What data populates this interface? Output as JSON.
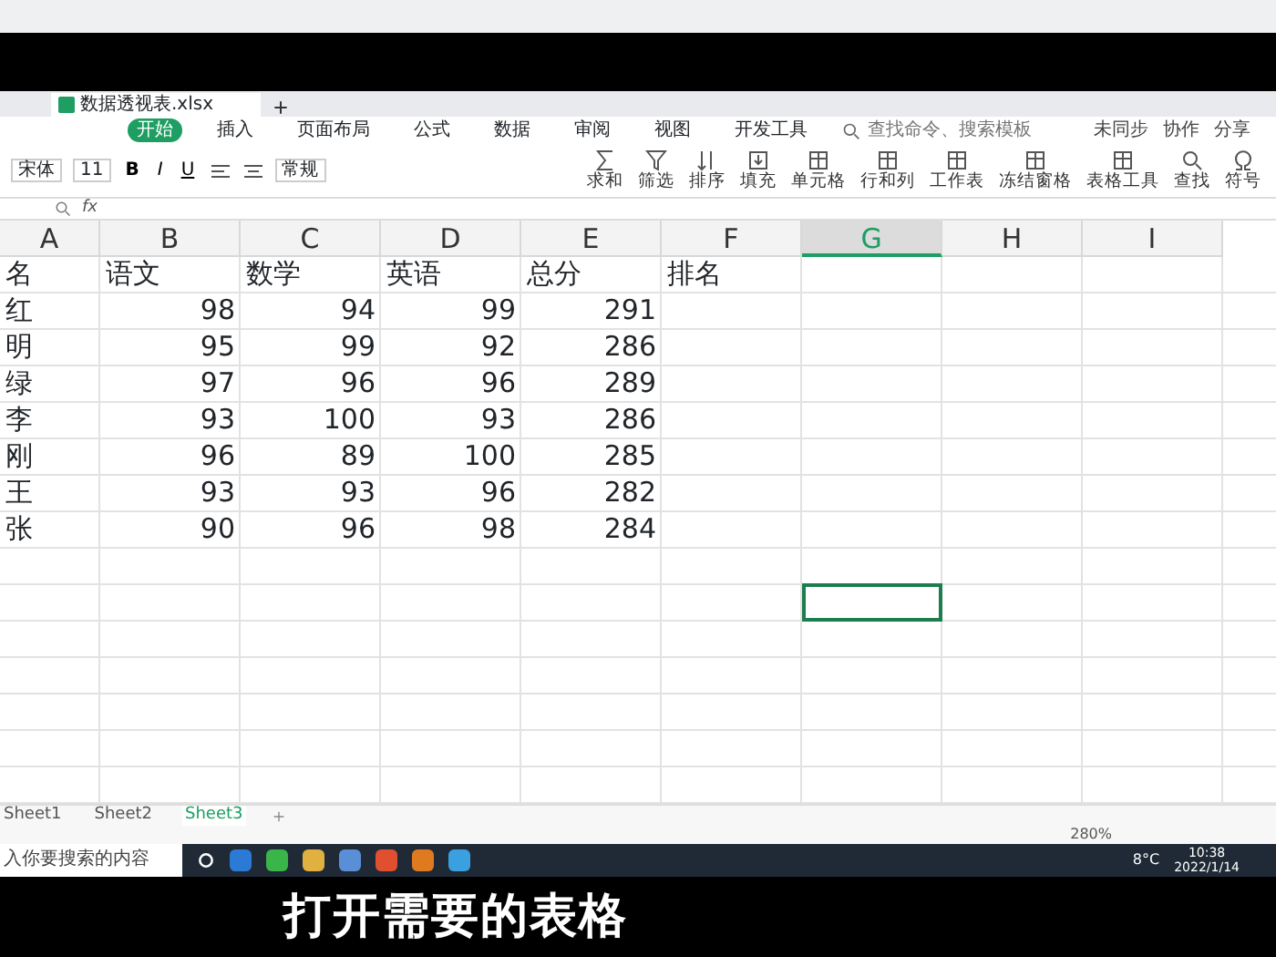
{
  "window": {
    "tab_title": "数据透视表.xlsx"
  },
  "menu_tabs": [
    {
      "label": "开始",
      "selected": true
    },
    {
      "label": "插入",
      "selected": false
    },
    {
      "label": "页面布局",
      "selected": false
    },
    {
      "label": "公式",
      "selected": false
    },
    {
      "label": "数据",
      "selected": false
    },
    {
      "label": "审阅",
      "selected": false
    },
    {
      "label": "视图",
      "selected": false
    },
    {
      "label": "开发工具",
      "selected": false
    }
  ],
  "search": {
    "placeholder": "查找命令、搜索模板"
  },
  "account": [
    "未同步",
    "协作",
    "分享"
  ],
  "ribbon": {
    "font_name": "宋体",
    "font_size": "11",
    "number_format": "常规",
    "format_buttons": [
      "B",
      "I",
      "U"
    ],
    "tools": [
      {
        "label": "求和",
        "kind": "sum"
      },
      {
        "label": "筛选",
        "kind": "filter"
      },
      {
        "label": "排序",
        "kind": "sort"
      },
      {
        "label": "填充",
        "kind": "fill"
      },
      {
        "label": "单元格",
        "kind": "table"
      },
      {
        "label": "行和列",
        "kind": "table"
      },
      {
        "label": "工作表",
        "kind": "table"
      },
      {
        "label": "冻结窗格",
        "kind": "table"
      },
      {
        "label": "表格工具",
        "kind": "table"
      },
      {
        "label": "查找",
        "kind": "search"
      },
      {
        "label": "符号",
        "kind": "symbol"
      }
    ]
  },
  "formula_bar": {
    "fx": "fx"
  },
  "sheet": {
    "columns": [
      {
        "label": "A",
        "selected": false
      },
      {
        "label": "B",
        "selected": false
      },
      {
        "label": "C",
        "selected": false
      },
      {
        "label": "D",
        "selected": false
      },
      {
        "label": "E",
        "selected": false
      },
      {
        "label": "F",
        "selected": false
      },
      {
        "label": "G",
        "selected": true
      },
      {
        "label": "H",
        "selected": false
      },
      {
        "label": "I",
        "selected": false
      }
    ],
    "rows": [
      [
        "名",
        "语文",
        "数学",
        "英语",
        "总分",
        "排名"
      ],
      [
        "红",
        "98",
        "94",
        "99",
        "291"
      ],
      [
        "明",
        "95",
        "99",
        "92",
        "286"
      ],
      [
        "绿",
        "97",
        "96",
        "96",
        "289"
      ],
      [
        "李",
        "93",
        "100",
        "93",
        "286"
      ],
      [
        "刚",
        "96",
        "89",
        "100",
        "285"
      ],
      [
        "王",
        "93",
        "93",
        "96",
        "282"
      ],
      [
        "张",
        "90",
        "96",
        "98",
        "284"
      ]
    ],
    "blank_rows": [
      {
        "selected": false
      },
      {
        "selected": true
      },
      {
        "selected": false
      },
      {
        "selected": false
      },
      {
        "selected": false
      },
      {
        "selected": false
      },
      {
        "selected": false
      }
    ]
  },
  "sheet_tabs": [
    {
      "label": "Sheet1",
      "selected": false
    },
    {
      "label": "Sheet2",
      "selected": false
    },
    {
      "label": "Sheet3",
      "selected": true
    }
  ],
  "status_bar": {
    "zoom": "280%"
  },
  "taskbar": {
    "search_placeholder": "入你要搜索的内容",
    "weather": "8°C",
    "time": "10:38",
    "date": "2022/1/14"
  },
  "subtitle": "打开需要的表格"
}
